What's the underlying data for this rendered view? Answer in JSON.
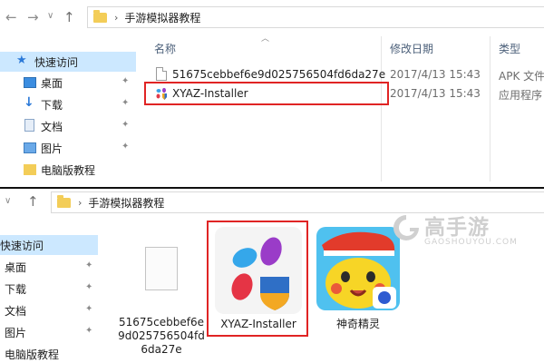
{
  "top": {
    "address": {
      "path": "手游模拟器教程",
      "sep": "›"
    },
    "sidebar": [
      {
        "label": "快速访问",
        "icon": "star-icon",
        "pinned": false,
        "selected": true
      },
      {
        "label": "桌面",
        "icon": "desktop-icon",
        "pinned": true
      },
      {
        "label": "下载",
        "icon": "download-icon",
        "pinned": true
      },
      {
        "label": "文档",
        "icon": "document-icon",
        "pinned": true
      },
      {
        "label": "图片",
        "icon": "picture-icon",
        "pinned": true
      },
      {
        "label": "电脑版教程",
        "icon": "folder-icon",
        "pinned": false
      }
    ],
    "columns": {
      "name": "名称",
      "date": "修改日期",
      "type": "类型"
    },
    "files": [
      {
        "name": "51675cebbef6e9d025756504fd6da27e",
        "date": "2017/4/13 15:43",
        "type": "APK 文件",
        "icon": "file-icon"
      },
      {
        "name": "XYAZ-Installer",
        "date": "2017/4/13 15:43",
        "type": "应用程序",
        "icon": "xyaz-app-icon"
      }
    ]
  },
  "bottom": {
    "address": {
      "path": "手游模拟器教程",
      "sep": "›"
    },
    "sidebar": [
      {
        "label": "快速访问",
        "selected": true
      },
      {
        "label": "桌面",
        "pinned": true
      },
      {
        "label": "下载",
        "pinned": true
      },
      {
        "label": "文档",
        "pinned": true
      },
      {
        "label": "图片",
        "pinned": true
      },
      {
        "label": "电脑版教程",
        "pinned": false
      }
    ],
    "tiles": [
      {
        "label_lines": [
          "51675cebbef6e",
          "9d025756504fd",
          "6da27e"
        ],
        "icon": "file-icon"
      },
      {
        "label_lines": [
          "XYAZ-Installer"
        ],
        "icon": "xyaz-app-icon"
      },
      {
        "label_lines": [
          "神奇精灵"
        ],
        "icon": "pikachu-game-icon"
      }
    ]
  },
  "watermark": {
    "text": "高手游",
    "sub": "GAOSHOUYOU.COM"
  },
  "colors": {
    "highlight": "#e02424",
    "selected": "#cce8ff",
    "folder": "#f3cd58"
  }
}
